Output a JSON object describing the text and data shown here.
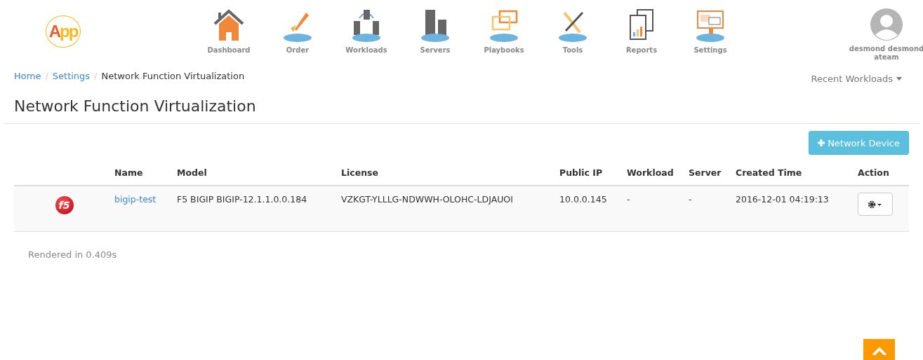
{
  "logo": {
    "text": "App"
  },
  "nav": [
    {
      "label": "Dashboard"
    },
    {
      "label": "Order"
    },
    {
      "label": "Workloads"
    },
    {
      "label": "Servers"
    },
    {
      "label": "Playbooks"
    },
    {
      "label": "Tools"
    },
    {
      "label": "Reports"
    },
    {
      "label": "Settings"
    }
  ],
  "user": {
    "name": "desmond desmond",
    "team": "ateam"
  },
  "breadcrumb_separator": "/",
  "breadcrumb": [
    {
      "label": "Home",
      "link": true
    },
    {
      "label": "Settings",
      "link": true
    },
    {
      "label": "Network Function Virtualization",
      "link": false
    }
  ],
  "recent_menu": "Recent Workloads",
  "page_title": "Network Function Virtualization",
  "add_button": "Network Device",
  "table": {
    "columns": [
      "Name",
      "Model",
      "License",
      "Public IP",
      "Workload",
      "Server",
      "Created Time",
      "Action"
    ],
    "rows": [
      {
        "logo_text": "f5",
        "name": "bigip-test",
        "model": "F5 BIGIP BIGIP-12.1.1.0.0.184",
        "license": "VZKGT-YLLLG-NDWWH-OLOHC-LDJAUOI",
        "public_ip": "10.0.0.145",
        "workload": "-",
        "server": "-",
        "created": "2016-12-01 04:19:13"
      }
    ]
  },
  "footer": "Rendered in 0.409s"
}
